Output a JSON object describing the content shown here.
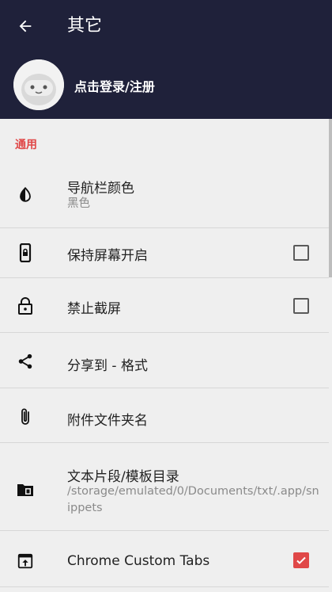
{
  "app_bar": {
    "title": "其它"
  },
  "profile": {
    "login_label": "点击登录/注册"
  },
  "section": {
    "header": "通用"
  },
  "settings": [
    {
      "title": "导航栏颜色",
      "subtitle": "黑色",
      "icon": "contrast-icon"
    },
    {
      "title": "保持屏幕开启",
      "icon": "phone-lock-icon",
      "checkbox": false
    },
    {
      "title": "禁止截屏",
      "icon": "lock-icon",
      "checkbox": false
    },
    {
      "title": "分享到 - 格式",
      "icon": "share-icon"
    },
    {
      "title": "附件文件夹名",
      "icon": "attachment-icon"
    },
    {
      "title": "文本片段/模板目录",
      "subtitle": "/storage/emulated/0/Documents/txt/.app/snippets",
      "icon": "folder-icon"
    },
    {
      "title": "Chrome Custom Tabs",
      "icon": "open-in-browser-icon",
      "checkbox": true
    }
  ],
  "colors": {
    "app_bar": "#1f213a",
    "accent": "#e04848",
    "background": "#efefef"
  }
}
